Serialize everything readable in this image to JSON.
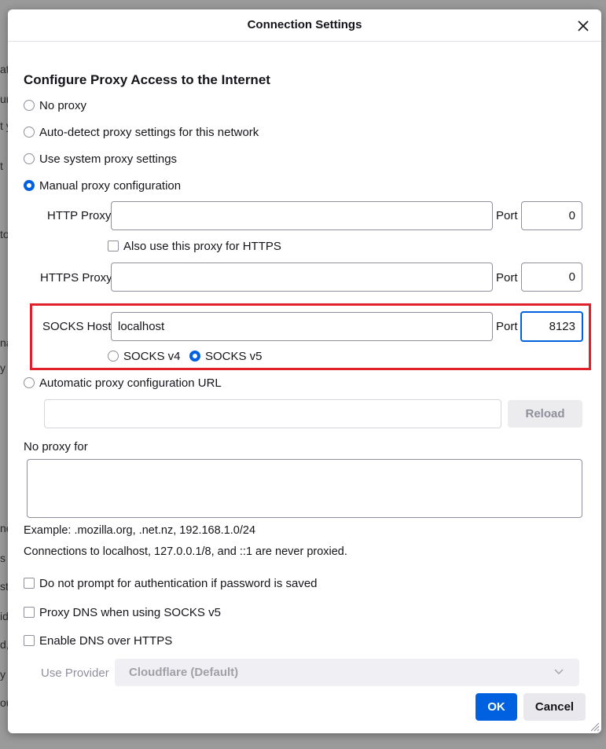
{
  "dialog": {
    "title": "Connection Settings",
    "heading": "Configure Proxy Access to the Internet"
  },
  "proxy_modes": {
    "no_proxy": "No proxy",
    "auto_detect": "Auto-detect proxy settings for this network",
    "system": "Use system proxy settings",
    "manual": "Manual proxy configuration",
    "auto_url": "Automatic proxy configuration URL",
    "selected": "manual"
  },
  "manual": {
    "http_label": "HTTP Proxy",
    "http_value": "",
    "port_label": "Port",
    "http_port": "0",
    "also_https_label": "Also use this proxy for HTTPS",
    "https_label": "HTTPS Proxy",
    "https_value": "",
    "https_port": "0",
    "socks_label": "SOCKS Host",
    "socks_value": "localhost",
    "socks_port": "8123",
    "socks_v4": "SOCKS v4",
    "socks_v5": "SOCKS v5",
    "socks_version_selected": "v5"
  },
  "auto_config": {
    "url_value": "",
    "reload_label": "Reload"
  },
  "no_proxy_for": {
    "label": "No proxy for",
    "value": "",
    "example": "Example: .mozilla.org, .net.nz, 192.168.1.0/24",
    "note": "Connections to localhost, 127.0.0.1/8, and ::1 are never proxied."
  },
  "options": {
    "no_auth_prompt": "Do not prompt for authentication if password is saved",
    "proxy_dns": "Proxy DNS when using SOCKS v5",
    "enable_doh": "Enable DNS over HTTPS",
    "use_provider_label": "Use Provider",
    "provider_value": "Cloudflare (Default)"
  },
  "buttons": {
    "ok": "OK",
    "cancel": "Cancel"
  },
  "colors": {
    "accent": "#0061e0",
    "highlight": "#e0212b"
  },
  "background": {
    "fragments": [
      "at",
      "un",
      "t y",
      "t",
      "to",
      "na",
      "y",
      "ne",
      "s t",
      "sta",
      "id",
      "d,",
      "y",
      "ou"
    ]
  }
}
